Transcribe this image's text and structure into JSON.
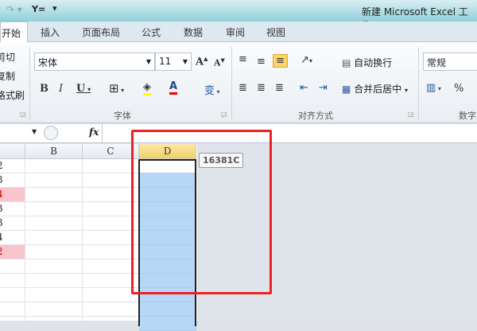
{
  "title": "新建 Microsoft Excel 工作",
  "tabs": [
    "开始",
    "插入",
    "页面布局",
    "公式",
    "数据",
    "审阅",
    "视图"
  ],
  "clipboard": {
    "cut": "剪切",
    "copy": "复制",
    "format_painter": "格式刷"
  },
  "font": {
    "name": "宋体",
    "size": "11",
    "group_label": "字体"
  },
  "alignment": {
    "wrap": "自动换行",
    "merge": "合并后居中",
    "group_label": "对齐方式"
  },
  "number": {
    "format": "常规",
    "percent": "%",
    "group_label": "数字"
  },
  "formula_bar": {
    "fx": "fx"
  },
  "columns": [
    "B",
    "C",
    "D"
  ],
  "col_a_values": [
    "2",
    "3",
    "4",
    "3",
    "3",
    "4",
    "2"
  ],
  "tooltip": "16381C",
  "colors": {
    "highlight": "#f9c4cc",
    "selection": "#b7d7f7",
    "annotation": "#ee2222"
  }
}
